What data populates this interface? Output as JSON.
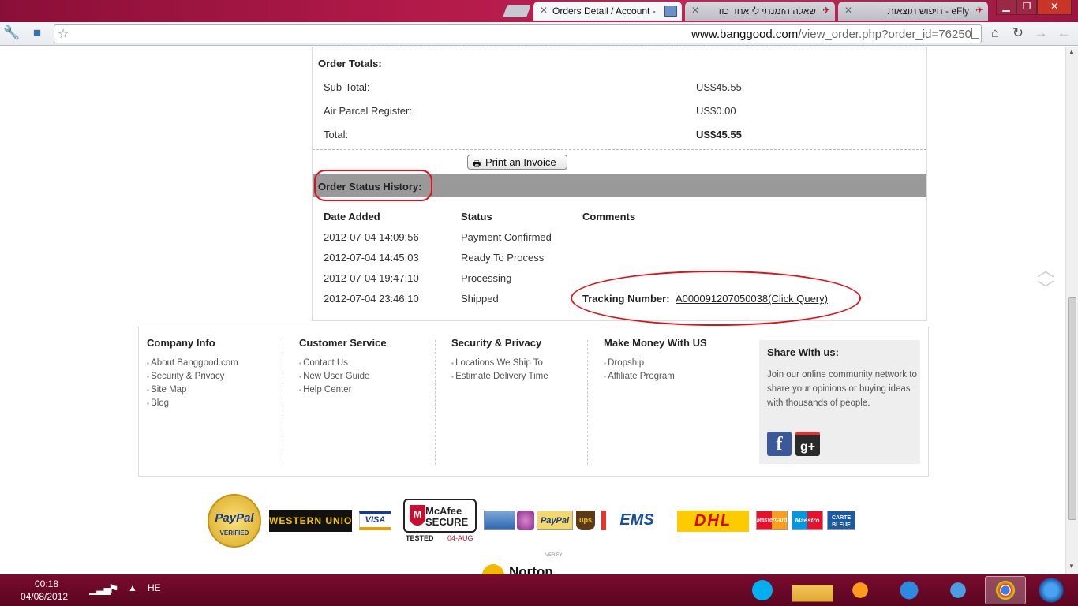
{
  "browser": {
    "tabs": [
      {
        "label": "Orders Detail / Account -"
      },
      {
        "label": "שאלה הזמנתי לי אחד כוז"
      },
      {
        "label": "eFly - חיפוש תוצאות"
      }
    ],
    "url_domain": "www.banggood.com",
    "url_path": "/view_order.php?order_id=76250"
  },
  "order": {
    "totals_heading": "Order Totals:",
    "rows": [
      {
        "label": "Sub-Total:",
        "value": "US$45.55"
      },
      {
        "label": "Air Parcel Register:",
        "value": "US$0.00"
      },
      {
        "label": "Total:",
        "value": "US$45.55"
      }
    ],
    "print_label": "Print an Invoice",
    "history_heading": "Order Status History:",
    "columns": [
      "Date Added",
      "Status",
      "Comments"
    ],
    "history": [
      {
        "date": "2012-07-04 14:09:56",
        "status": "Payment Confirmed"
      },
      {
        "date": "2012-07-04 14:45:03",
        "status": "Ready To Process"
      },
      {
        "date": "2012-07-04 19:47:10",
        "status": "Processing"
      },
      {
        "date": "2012-07-04 23:46:10",
        "status": "Shipped"
      }
    ],
    "tracking_label": "Tracking Number:",
    "tracking_link": "A000091207050038(Click Query)"
  },
  "footer": {
    "columns": [
      {
        "heading": "Company Info",
        "links": [
          "About Banggood.com",
          "Security & Privacy",
          "Site Map",
          "Blog"
        ]
      },
      {
        "heading": "Customer Service",
        "links": [
          "Contact Us",
          "New User Guide",
          "Help Center"
        ]
      },
      {
        "heading": "Security & Privacy",
        "links": [
          "Locations We Ship To",
          "Estimate Delivery Time"
        ]
      },
      {
        "heading": "Make Money With US",
        "links": [
          "Dropship",
          "Affiliate Program"
        ]
      }
    ],
    "share_heading": "Share With us:",
    "share_text": "Join our online community network to share your opinions or buying ideas with thousands of people."
  },
  "payment_logos": {
    "paypal_verified": "PayPal",
    "paypal_verified_sub": "VERIFIED",
    "western_union": "WESTERN UNION",
    "visa": "VISA",
    "mcafee": "McAfee SECURE",
    "mcafee_tested": "TESTED",
    "mcafee_date": "04-AUG",
    "paypal": "PayPal",
    "ems": "EMS",
    "dhl": "DHL",
    "mastercard": "MasterCard",
    "maestro": "Maestro",
    "carte_bleue": "CARTE BLEUE",
    "norton_verify": "VERIFY",
    "norton": "Norton"
  },
  "taskbar": {
    "time": "00:18",
    "date": "04/08/2012",
    "language": "HE"
  },
  "colors": {
    "accent_red": "#e0101a",
    "history_bar": "#999999",
    "titlebar": "#b31a4a"
  }
}
